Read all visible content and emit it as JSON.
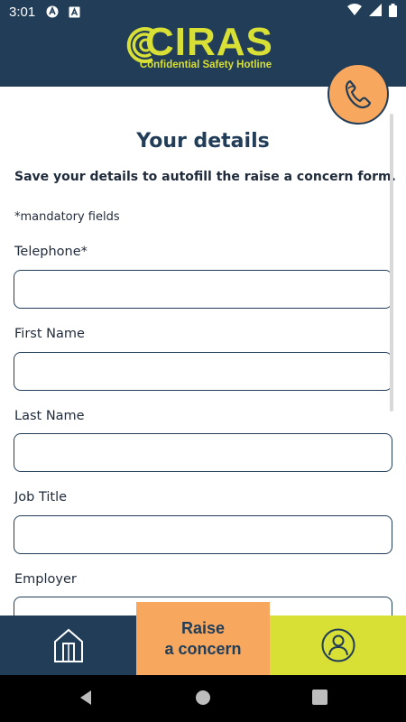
{
  "status_bar": {
    "time": "3:01"
  },
  "header": {
    "logo_text": "CIRAS",
    "logo_subtitle": "Confidential Safety Hotline",
    "brand_color": "#d8df35",
    "header_color": "#213d58"
  },
  "page": {
    "title": "Your details",
    "subtitle": "Save your details to autofill the raise a concern form.",
    "mandatory_note": "*mandatory fields"
  },
  "form": {
    "fields": [
      {
        "label": "Telephone*",
        "value": ""
      },
      {
        "label": "First Name",
        "value": ""
      },
      {
        "label": "Last Name",
        "value": ""
      },
      {
        "label": "Job Title",
        "value": ""
      },
      {
        "label": "Employer",
        "value": ""
      }
    ]
  },
  "bottom_nav": {
    "home_icon": "home-icon",
    "raise_label": "Raise\na concern",
    "profile_icon": "profile-icon",
    "accent_color": "#f8a85e"
  },
  "icons": {
    "phone": "phone-icon"
  }
}
